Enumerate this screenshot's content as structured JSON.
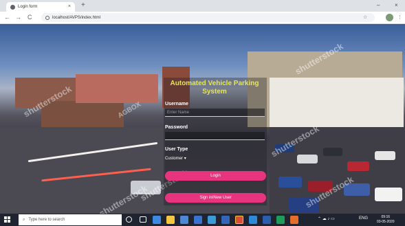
{
  "browser": {
    "tab_title": "Login form",
    "new_tab": "+",
    "win_min": "–",
    "win_close": "×",
    "back": "←",
    "forward": "→",
    "reload": "C",
    "url": "localhost/AVPS/index.html",
    "star": "☆",
    "menu": "⋮"
  },
  "page": {
    "title": "Automated Vehicle Parking System",
    "username_label": "Username",
    "username_placeholder": "Enter Name",
    "password_label": "Password",
    "usertype_label": "User Type",
    "usertype_selected": "Customer",
    "login_button": "Login",
    "signup_button": "Sign in/New User"
  },
  "watermarks": [
    "shutterstock",
    "shutterstock",
    "AGBOX",
    "shutterstock",
    "shutterstock",
    "shutterstock",
    "shutterstock"
  ],
  "taskbar": {
    "search_placeholder": "Type here to search",
    "tray_lang": "ENG",
    "time": "09:16",
    "date": "03-05-2020"
  },
  "colors": {
    "accent_button": "#e8337e",
    "title_yellow": "#e9e84a"
  }
}
